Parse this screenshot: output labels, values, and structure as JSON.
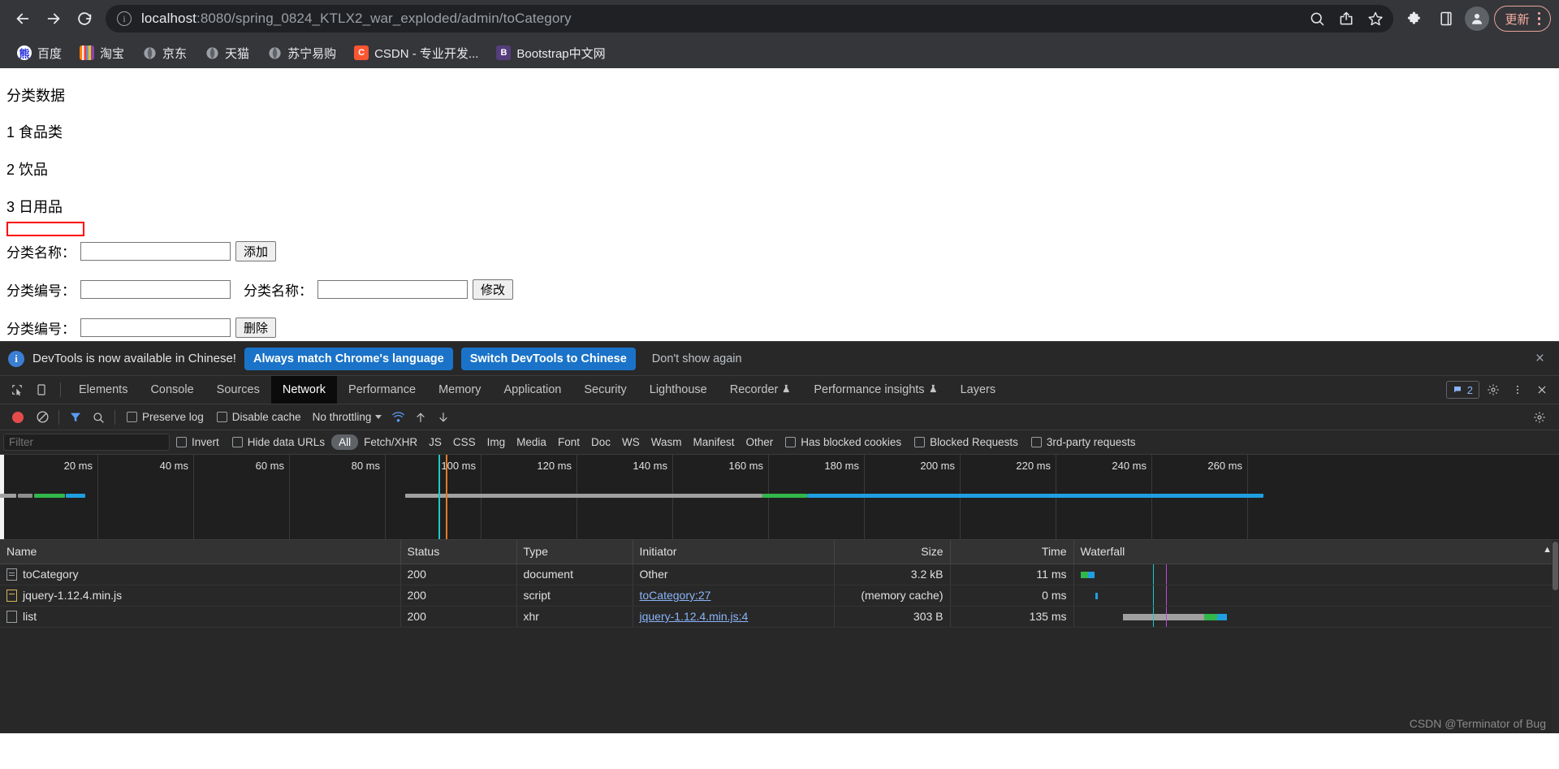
{
  "browser": {
    "nav": {
      "back": "back-arrow",
      "forward": "forward-arrow",
      "reload": "reload"
    },
    "omnibox": {
      "host": "localhost",
      "path": ":8080/spring_0824_KTLX2_war_exploded/admin/toCategory",
      "full_url": "localhost:8080/spring_0824_KTLX2_war_exploded/admin/toCategory"
    },
    "toolbar_right": {
      "update_label": "更新"
    },
    "bookmarks": [
      {
        "label": "百度",
        "icon": "baidu-favicon"
      },
      {
        "label": "淘宝",
        "icon": "taobao-favicon"
      },
      {
        "label": "京东",
        "icon": "globe-favicon"
      },
      {
        "label": "天猫",
        "icon": "globe-favicon"
      },
      {
        "label": "苏宁易购",
        "icon": "globe-favicon"
      },
      {
        "label": "CSDN - 专业开发...",
        "icon": "csdn-favicon"
      },
      {
        "label": "Bootstrap中文网",
        "icon": "bootstrap-favicon"
      }
    ]
  },
  "page": {
    "title": "分类数据",
    "categories": [
      {
        "line": "1 食品类"
      },
      {
        "line": "2 饮品"
      },
      {
        "line": "3 日用品"
      }
    ],
    "forms": {
      "add": {
        "label": "分类名称：",
        "value": "",
        "button": "添加"
      },
      "update": {
        "label_id": "分类编号：",
        "value_id": "",
        "label_name": "分类名称：",
        "value_name": "",
        "button": "修改"
      },
      "delete": {
        "label_id": "分类编号：",
        "value_id": "",
        "button": "删除"
      }
    }
  },
  "devtools": {
    "banner": {
      "message": "DevTools is now available in Chinese!",
      "btn_always": "Always match Chrome's language",
      "btn_switch": "Switch DevTools to Chinese",
      "btn_dismiss": "Don't show again",
      "close": "×"
    },
    "tabs": [
      {
        "label": "Elements",
        "active": false
      },
      {
        "label": "Console",
        "active": false
      },
      {
        "label": "Sources",
        "active": false
      },
      {
        "label": "Network",
        "active": true
      },
      {
        "label": "Performance",
        "active": false
      },
      {
        "label": "Memory",
        "active": false
      },
      {
        "label": "Application",
        "active": false
      },
      {
        "label": "Security",
        "active": false
      },
      {
        "label": "Lighthouse",
        "active": false
      },
      {
        "label": "Recorder",
        "active": false,
        "beaker": true
      },
      {
        "label": "Performance insights",
        "active": false,
        "beaker": true
      },
      {
        "label": "Layers",
        "active": false
      }
    ],
    "issues_count": "2",
    "controls": {
      "preserve_log": "Preserve log",
      "disable_cache": "Disable cache",
      "throttling": "No throttling"
    },
    "filter": {
      "placeholder": "Filter",
      "invert": "Invert",
      "hide_data_urls": "Hide data URLs",
      "types": [
        "All",
        "Fetch/XHR",
        "JS",
        "CSS",
        "Img",
        "Media",
        "Font",
        "Doc",
        "WS",
        "Wasm",
        "Manifest",
        "Other"
      ],
      "selected_type": "All",
      "has_blocked_cookies": "Has blocked cookies",
      "blocked_requests": "Blocked Requests",
      "third_party": "3rd-party requests"
    },
    "overview": {
      "ticks": [
        "20 ms",
        "40 ms",
        "60 ms",
        "80 ms",
        "100 ms",
        "120 ms",
        "140 ms",
        "160 ms",
        "180 ms",
        "200 ms",
        "220 ms",
        "240 ms",
        "260 ms"
      ]
    },
    "table": {
      "columns": [
        "Name",
        "Status",
        "Type",
        "Initiator",
        "Size",
        "Time",
        "Waterfall"
      ],
      "rows": [
        {
          "name": "toCategory",
          "icon": "document-icon",
          "status": "200",
          "type": "document",
          "initiator": "Other",
          "initiator_link": false,
          "size": "3.2 kB",
          "time": "11 ms"
        },
        {
          "name": "jquery-1.12.4.min.js",
          "icon": "script-icon",
          "status": "200",
          "type": "script",
          "initiator": "toCategory:27",
          "initiator_link": true,
          "size": "(memory cache)",
          "time": "0 ms"
        },
        {
          "name": "list",
          "icon": "xhr-icon",
          "status": "200",
          "type": "xhr",
          "initiator": "jquery-1.12.4.min.js:4",
          "initiator_link": true,
          "size": "303 B",
          "time": "135 ms"
        }
      ]
    },
    "watermark": "CSDN @Terminator of Bug"
  },
  "colors": {
    "chrome_toolbar": "#35363a",
    "omnibox_bg": "#202124",
    "devtools_bg": "#282828",
    "accent_blue": "#1a73c8",
    "link_blue": "#8ab4f8",
    "update_pill": "#f6aea1",
    "red_box": "#ff0000",
    "record_red": "#e54b4b"
  }
}
